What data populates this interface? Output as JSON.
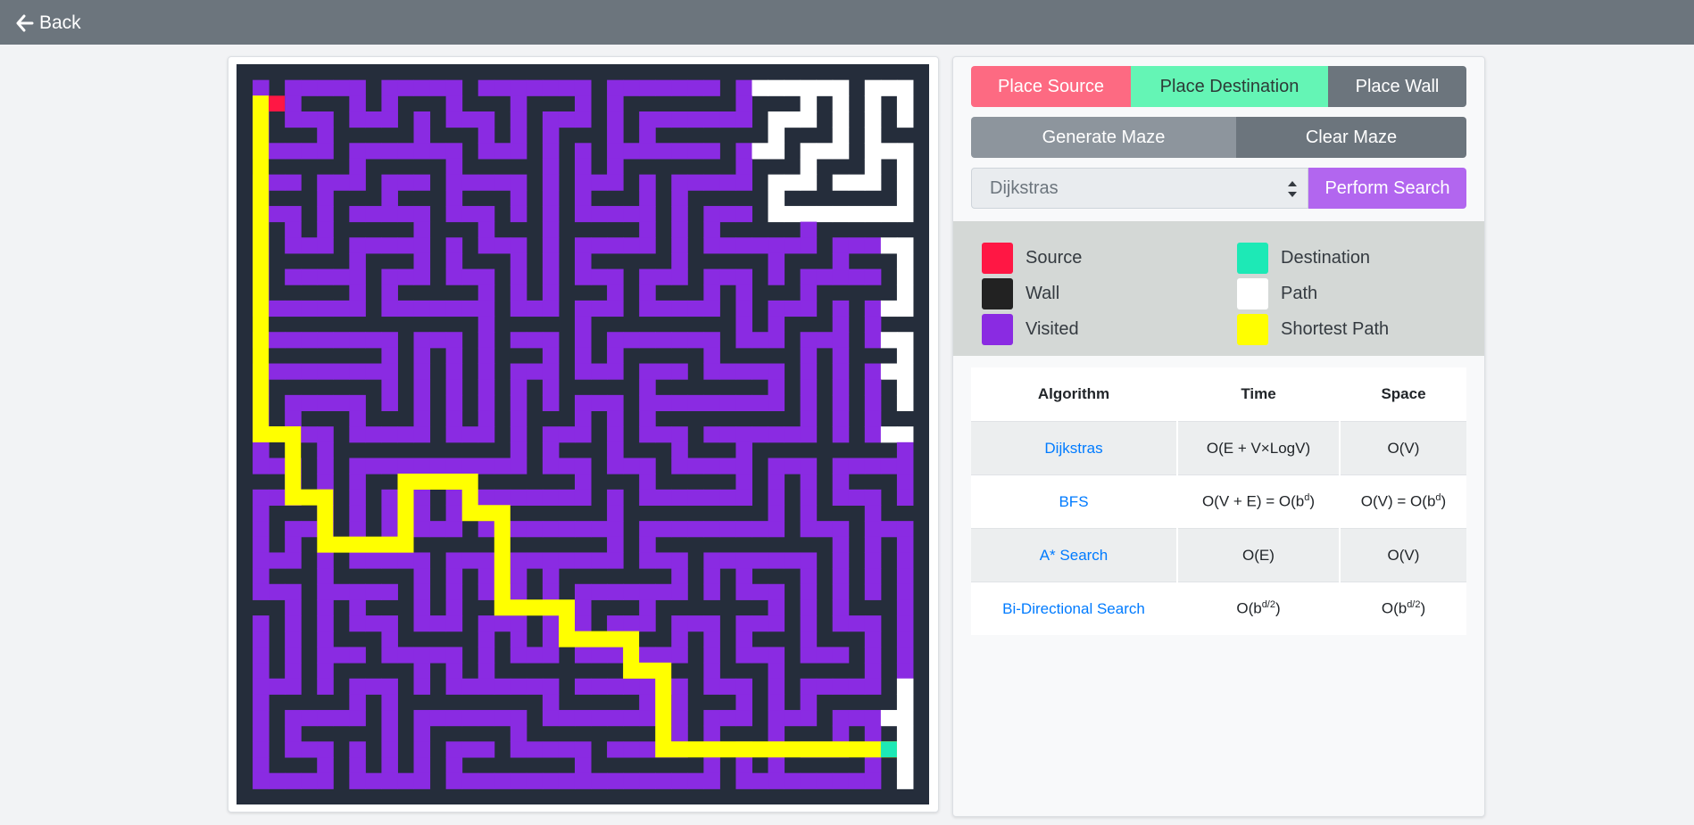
{
  "nav": {
    "back_label": "Back",
    "back_icon": "arrow-left-icon"
  },
  "maze": {
    "rows": 23,
    "cols": 23,
    "colors": {
      "wall": "#252d3b",
      "path": "#ffffff",
      "visited": "#8a2be2",
      "shortest": "#ffff00",
      "source": "#ff1744",
      "destination": "#1de9b6"
    }
  },
  "controls": {
    "place_source": "Place Source",
    "place_destination": "Place Destination",
    "place_wall": "Place Wall",
    "generate_maze": "Generate Maze",
    "clear_maze": "Clear Maze",
    "algorithm_selected": "Dijkstras",
    "perform_search": "Perform Search"
  },
  "legend": [
    {
      "label": "Source",
      "color": "#ff1744"
    },
    {
      "label": "Wall",
      "color": "#222222"
    },
    {
      "label": "Visited",
      "color": "#8a2be2"
    },
    {
      "label": "Destination",
      "color": "#1de9b6"
    },
    {
      "label": "Path",
      "color": "#ffffff"
    },
    {
      "label": "Shortest Path",
      "color": "#ffff00"
    }
  ],
  "table": {
    "headers": [
      "Algorithm",
      "Time",
      "Space"
    ],
    "rows": [
      {
        "name": "Dijkstras",
        "time": [
          "O(E + V×LogV)"
        ],
        "space": [
          "O(V)"
        ]
      },
      {
        "name": "BFS",
        "time": [
          "O(V + E) = O(b",
          "d",
          ")"
        ],
        "space": [
          "O(V) = O(b",
          "d",
          ")"
        ]
      },
      {
        "name": "A* Search",
        "time": [
          "O(E)"
        ],
        "space": [
          "O(V)"
        ]
      },
      {
        "name": "Bi-Directional Search",
        "time": [
          "O(b",
          "d/2",
          ")"
        ],
        "space": [
          "O(b",
          "d/2",
          ")"
        ]
      }
    ]
  }
}
